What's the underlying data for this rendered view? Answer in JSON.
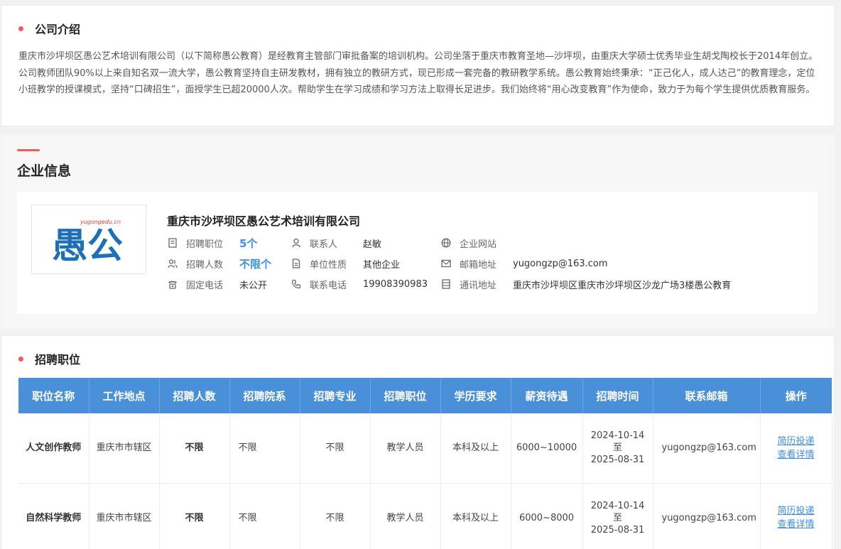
{
  "intro": {
    "title": "公司介绍",
    "text": "重庆市沙坪坝区愚公艺术培训有限公司（以下简称愚公教育）是经教育主管部门审批备案的培训机构。公司坐落于重庆市教育圣地—沙坪坝，由重庆大学硕士优秀毕业生胡戈陶校长于2014年创立。公司教师团队90%以上来自知名双一流大学，愚公教育坚持自主研发教材，拥有独立的教研方式，现已形成一套完备的教研教学系统。愚公教育始终秉承：“正己化人，成人达己”的教育理念，定位小班教学的授课模式，坚持“口碑招生”，面授学生已超20000人次。帮助学生在学习成绩和学习方法上取得长足进步。我们始终将“用心改变教育”作为使命，致力于为每个学生提供优质教育服务。"
  },
  "company": {
    "section_title": "企业信息",
    "name": "重庆市沙坪坝区愚公艺术培训有限公司",
    "logo": {
      "url_text": "yugongedu.cn",
      "glyph": "愚公"
    },
    "info": {
      "positions_label": "招聘职位",
      "positions_value": "5个",
      "headcount_label": "招聘人数",
      "headcount_value": "不限个",
      "phone_label": "固定电话",
      "phone_value": "未公开",
      "contact_label": "联系人",
      "contact_value": "赵敏",
      "nature_label": "单位性质",
      "nature_value": "其他企业",
      "tel_label": "联系电话",
      "tel_value": "19908390983",
      "website_label": "企业网站",
      "website_value": "",
      "email_label": "邮箱地址",
      "email_value": "yugongzp@163.com",
      "address_label": "通讯地址",
      "address_value": "重庆市沙坪坝区重庆市沙坪坝区沙龙广场3楼愚公教育"
    }
  },
  "jobs": {
    "title": "招聘职位",
    "headers": [
      "职位名称",
      "工作地点",
      "招聘人数",
      "招聘院系",
      "招聘专业",
      "招聘职位",
      "学历要求",
      "薪资待遇",
      "招聘时间",
      "联系邮箱",
      "操作"
    ],
    "rows": [
      {
        "name": "人文创作教师",
        "location": "重庆市市辖区",
        "count": "不限",
        "dept": "不限",
        "major": "不限",
        "position": "教学人员",
        "edu": "本科及以上",
        "salary": "6000~10000",
        "time_start": "2024-10-14",
        "time_sep": "至",
        "time_end": "2025-08-31",
        "email": "yugongzp@163.com",
        "action1": "简历投递",
        "action2": "查看详情"
      },
      {
        "name": "自然科学教师",
        "location": "重庆市市辖区",
        "count": "不限",
        "dept": "不限",
        "major": "不限",
        "position": "教学人员",
        "edu": "本科及以上",
        "salary": "6000~8000",
        "time_start": "2024-10-14",
        "time_sep": "至",
        "time_end": "2025-08-31",
        "email": "yugongzp@163.com",
        "action1": "简历投递",
        "action2": "查看详情"
      }
    ]
  },
  "colors": {
    "accent": "#f25a5a",
    "table_header": "#4a90d9",
    "link": "#3a8ee6",
    "logo_blue": "#1d6fb8"
  }
}
